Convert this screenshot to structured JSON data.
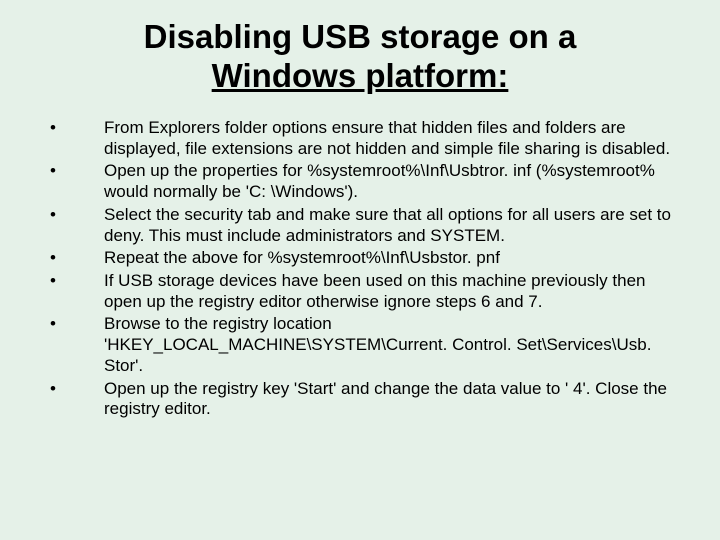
{
  "title_line1": "Disabling USB storage on a",
  "title_line2": "Windows platform:",
  "bullets": [
    "From Explorers folder options ensure that hidden files and folders are displayed, file extensions are not hidden and simple file sharing is disabled.",
    "Open up the properties for %systemroot%\\Inf\\Usbtror. inf (%systemroot% would normally be 'C: \\Windows').",
    "Select the security tab and make sure that all options for all users are set to deny. This must include administrators and SYSTEM.",
    "Repeat the above for %systemroot%\\Inf\\Usbstor. pnf",
    "If USB storage devices have been used on this machine previously then open up the registry editor otherwise ignore steps 6 and 7.",
    "Browse to the registry location 'HKEY_LOCAL_MACHINE\\SYSTEM\\Current. Control. Set\\Services\\Usb. Stor'.",
    "Open up the registry key 'Start' and change the data value to ' 4'. Close the registry editor."
  ]
}
